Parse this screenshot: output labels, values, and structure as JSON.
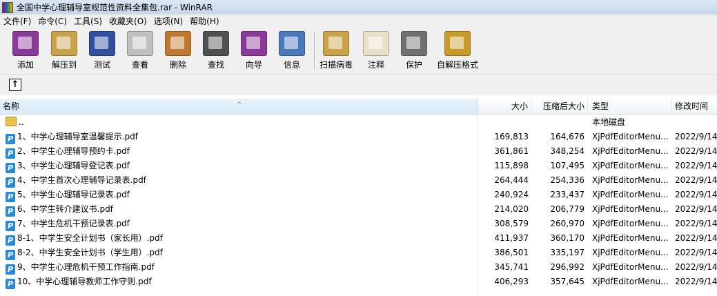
{
  "window": {
    "title": "全国中学心理辅导室规范性资料全集包.rar - WinRAR"
  },
  "menu": [
    "文件(F)",
    "命令(C)",
    "工具(S)",
    "收藏夹(O)",
    "选项(N)",
    "帮助(H)"
  ],
  "toolbar": [
    {
      "label": "添加",
      "icon": "add-archive-icon",
      "color": "#8a3a9a"
    },
    {
      "label": "解压到",
      "icon": "extract-to-icon",
      "color": "#c9a24a"
    },
    {
      "label": "测试",
      "icon": "test-icon",
      "color": "#3050a0"
    },
    {
      "label": "查看",
      "icon": "view-icon",
      "color": "#c0c0c0"
    },
    {
      "label": "删除",
      "icon": "delete-icon",
      "color": "#c07830"
    },
    {
      "label": "查找",
      "icon": "find-icon",
      "color": "#505050"
    },
    {
      "label": "向导",
      "icon": "wizard-icon",
      "color": "#8a3a9a"
    },
    {
      "label": "信息",
      "icon": "info-icon",
      "color": "#4a78b8"
    },
    {
      "label": "扫描病毒",
      "icon": "scan-virus-icon",
      "color": "#c9a24a"
    },
    {
      "label": "注释",
      "icon": "comment-icon",
      "color": "#e8e0c8"
    },
    {
      "label": "保护",
      "icon": "protect-icon",
      "color": "#707070"
    },
    {
      "label": "自解压格式",
      "icon": "sfx-icon",
      "color": "#c99a2a"
    }
  ],
  "columns": {
    "name": "名称",
    "size": "大小",
    "packed": "压缩后大小",
    "type": "类型",
    "modified": "修改时间"
  },
  "parent_row": {
    "name": "..",
    "type": "本地磁盘"
  },
  "files": [
    {
      "name": "1、中学心理辅导室温馨提示.pdf",
      "size": "169,813",
      "packed": "164,676",
      "type": "XjPdfEditorMenu...",
      "modified": "2022/9/14"
    },
    {
      "name": "2、中学生心理辅导预约卡.pdf",
      "size": "361,861",
      "packed": "348,254",
      "type": "XjPdfEditorMenu...",
      "modified": "2022/9/14"
    },
    {
      "name": "3、中学生心理辅导登记表.pdf",
      "size": "115,898",
      "packed": "107,495",
      "type": "XjPdfEditorMenu...",
      "modified": "2022/9/14"
    },
    {
      "name": "4、中学生首次心理辅导记录表.pdf",
      "size": "264,444",
      "packed": "254,336",
      "type": "XjPdfEditorMenu...",
      "modified": "2022/9/14"
    },
    {
      "name": "5、中学生心理辅导记录表.pdf",
      "size": "240,924",
      "packed": "233,437",
      "type": "XjPdfEditorMenu...",
      "modified": "2022/9/14"
    },
    {
      "name": "6、中学生转介建议书.pdf",
      "size": "214,020",
      "packed": "206,779",
      "type": "XjPdfEditorMenu...",
      "modified": "2022/9/14"
    },
    {
      "name": "7、中学生危机干预记录表.pdf",
      "size": "308,579",
      "packed": "260,970",
      "type": "XjPdfEditorMenu...",
      "modified": "2022/9/14"
    },
    {
      "name": "8-1、中学生安全计划书（家长用）.pdf",
      "size": "411,937",
      "packed": "360,170",
      "type": "XjPdfEditorMenu...",
      "modified": "2022/9/14"
    },
    {
      "name": "8-2、中学生安全计划书（学生用）.pdf",
      "size": "386,501",
      "packed": "335,197",
      "type": "XjPdfEditorMenu...",
      "modified": "2022/9/14"
    },
    {
      "name": "9、中学生心理危机干预工作指南.pdf",
      "size": "345,741",
      "packed": "296,992",
      "type": "XjPdfEditorMenu...",
      "modified": "2022/9/14"
    },
    {
      "name": "10、中学心理辅导教师工作守则.pdf",
      "size": "406,293",
      "packed": "357,645",
      "type": "XjPdfEditorMenu...",
      "modified": "2022/9/14"
    }
  ]
}
